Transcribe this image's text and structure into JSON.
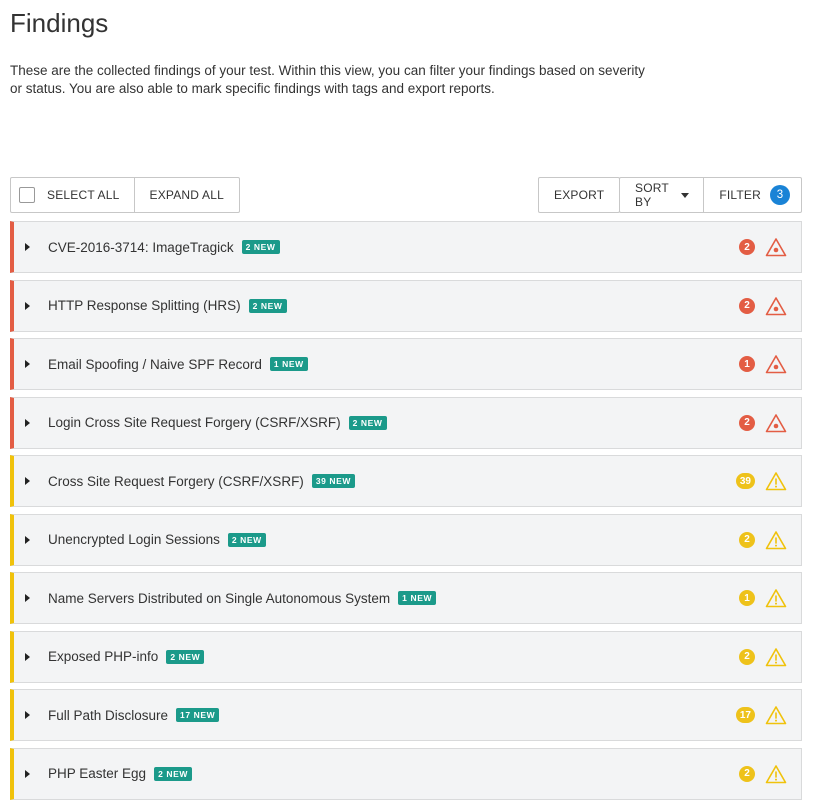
{
  "page": {
    "title": "Findings",
    "description": "These are the collected findings of your test. Within this view, you can filter your findings based on severity or status. You are also able to mark specific findings with tags and export reports."
  },
  "toolbar": {
    "select_all": "SELECT ALL",
    "expand_all": "EXPAND ALL",
    "export": "EXPORT",
    "sort_by": "SORT BY",
    "filter": "FILTER",
    "filter_count": "3"
  },
  "colors": {
    "high": "#e35d44",
    "medium": "#f0c20b",
    "new_badge": "#1b9a8a",
    "filter_badge": "#1a83d6"
  },
  "findings": [
    {
      "title": "CVE-2016-3714: ImageTragick",
      "badge": "2 NEW",
      "count": "2",
      "severity": "high",
      "icon": "alert-triangle-icon"
    },
    {
      "title": "HTTP Response Splitting (HRS)",
      "badge": "2 NEW",
      "count": "2",
      "severity": "high",
      "icon": "alert-triangle-icon"
    },
    {
      "title": "Email Spoofing / Naive SPF Record",
      "badge": "1 NEW",
      "count": "1",
      "severity": "high",
      "icon": "alert-triangle-icon"
    },
    {
      "title": "Login Cross Site Request Forgery (CSRF/XSRF)",
      "badge": "2 NEW",
      "count": "2",
      "severity": "high",
      "icon": "alert-triangle-icon"
    },
    {
      "title": "Cross Site Request Forgery (CSRF/XSRF)",
      "badge": "39 NEW",
      "count": "39",
      "severity": "medium",
      "icon": "warning-triangle-icon"
    },
    {
      "title": "Unencrypted Login Sessions",
      "badge": "2 NEW",
      "count": "2",
      "severity": "medium",
      "icon": "warning-triangle-icon"
    },
    {
      "title": "Name Servers Distributed on Single Autonomous System",
      "badge": "1 NEW",
      "count": "1",
      "severity": "medium",
      "icon": "warning-triangle-icon"
    },
    {
      "title": "Exposed PHP-info",
      "badge": "2 NEW",
      "count": "2",
      "severity": "medium",
      "icon": "warning-triangle-icon"
    },
    {
      "title": "Full Path Disclosure",
      "badge": "17 NEW",
      "count": "17",
      "severity": "medium",
      "icon": "warning-triangle-icon"
    },
    {
      "title": "PHP Easter Egg",
      "badge": "2 NEW",
      "count": "2",
      "severity": "medium",
      "icon": "warning-triangle-icon"
    }
  ]
}
